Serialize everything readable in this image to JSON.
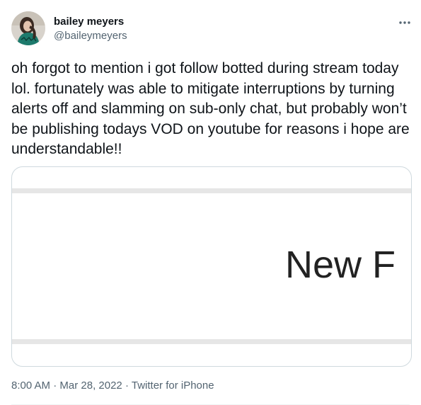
{
  "author": {
    "display_name": "bailey meyers",
    "handle": "@baileymeyers"
  },
  "more_button": {
    "icon": "more-horizontal-icon",
    "glyph": "···"
  },
  "tweet": {
    "text": "oh forgot to mention i got follow botted during stream today lol. fortunately was able to mitigate interruptions by turning alerts off and slamming on sub-only chat, but probably won’t be publishing todays VOD on youtube for reasons i hope are understandable!!"
  },
  "media": {
    "visible_text": "New F"
  },
  "meta": {
    "time": "8:00 AM",
    "separator": "·",
    "date": "Mar 28, 2022",
    "source": "Twitter for iPhone"
  },
  "colors": {
    "text_primary": "#0f1419",
    "text_secondary": "#536471",
    "border": "#cfd9de"
  }
}
